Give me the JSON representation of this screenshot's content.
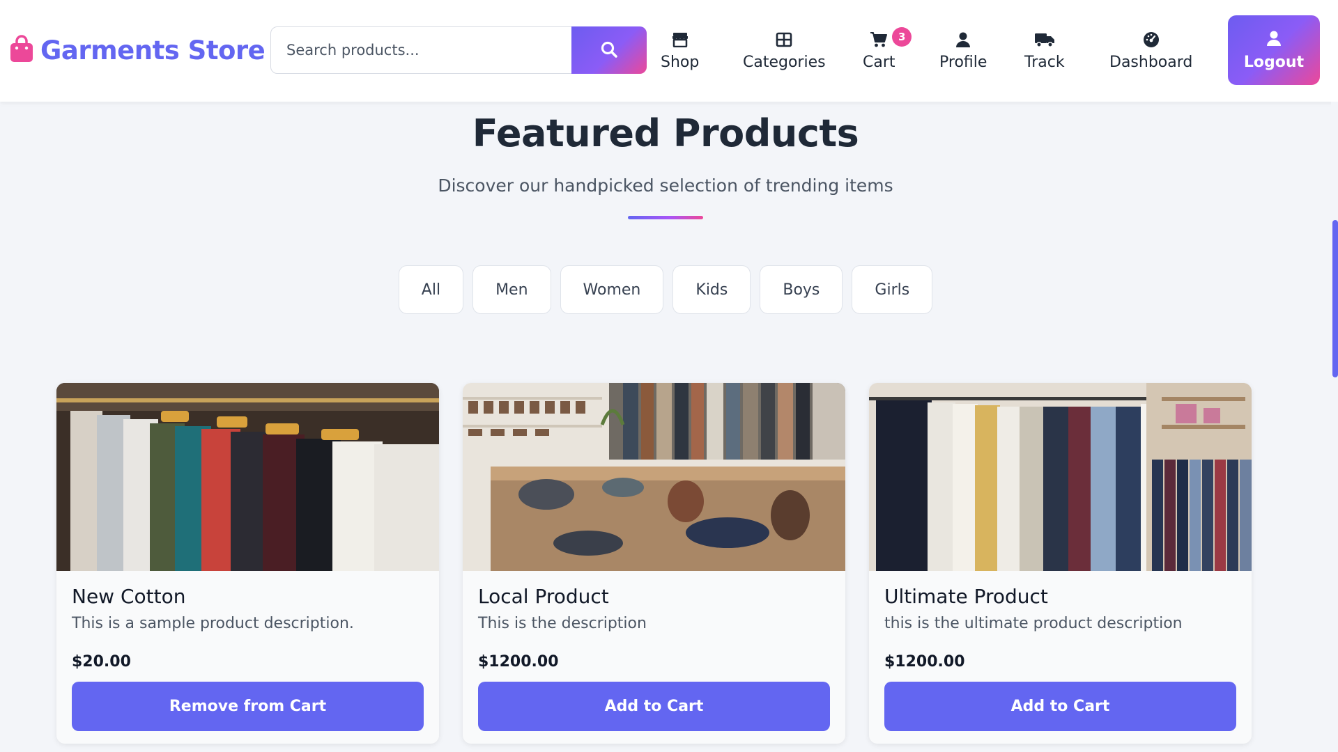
{
  "header": {
    "brand": "Garments Store",
    "search": {
      "placeholder": "Search products..."
    },
    "nav": [
      {
        "label": "Shop",
        "icon": "store-icon"
      },
      {
        "label": "Categories",
        "icon": "grid-icon"
      },
      {
        "label": "Cart",
        "icon": "cart-icon",
        "badge": "3"
      },
      {
        "label": "Profile",
        "icon": "user-icon"
      },
      {
        "label": "Track",
        "icon": "truck-icon"
      },
      {
        "label": "Dashboard",
        "icon": "gauge-icon"
      }
    ],
    "logout": {
      "label": "Logout",
      "icon": "user-icon"
    }
  },
  "section": {
    "title": "Featured Products",
    "subtitle": "Discover our handpicked selection of trending items"
  },
  "filters": [
    "All",
    "Men",
    "Women",
    "Kids",
    "Boys",
    "Girls"
  ],
  "products": [
    {
      "title": "New Cotton",
      "description": "This is a sample product description.",
      "price": "$20.00",
      "button": "Remove from Cart"
    },
    {
      "title": "Local Product",
      "description": "This is the description",
      "price": "$1200.00",
      "button": "Add to Cart"
    },
    {
      "title": "Ultimate Product",
      "description": "this is the ultimate product description",
      "price": "$1200.00",
      "button": "Add to Cart"
    }
  ],
  "colors": {
    "accent": "#6366f1",
    "accent_pink": "#ec4899",
    "background": "#f3f5f9"
  }
}
